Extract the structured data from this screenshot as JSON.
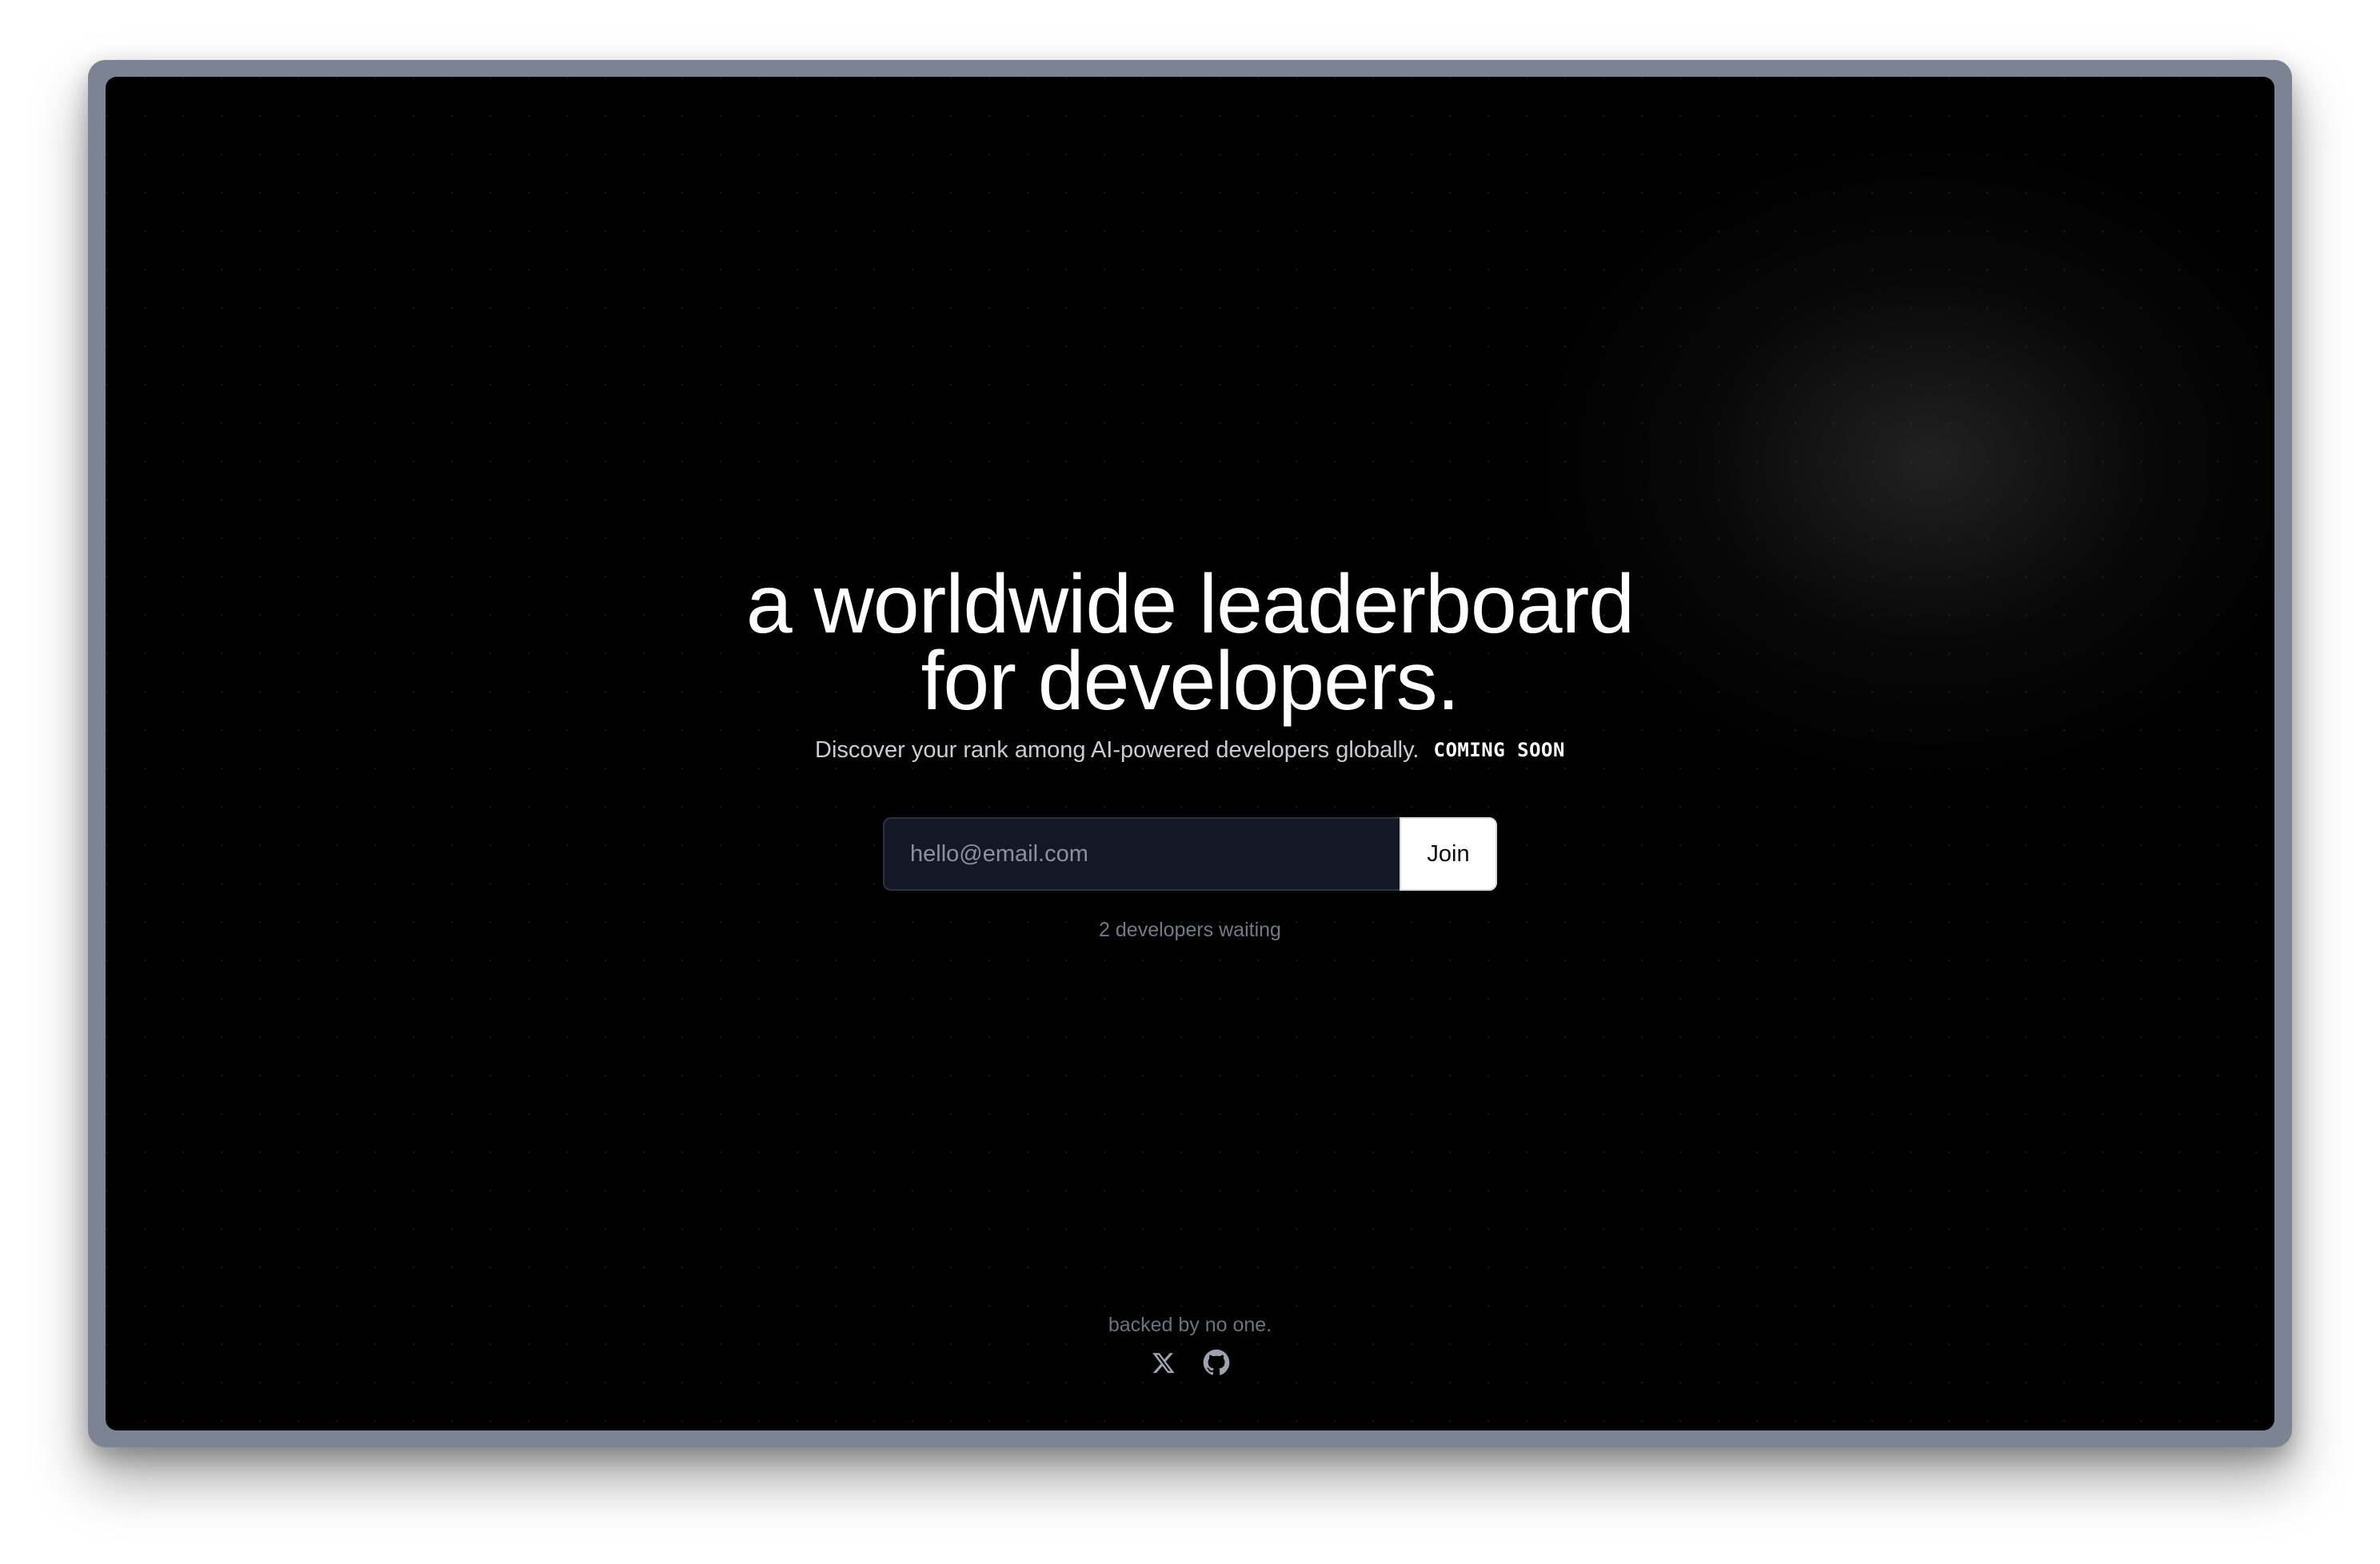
{
  "hero": {
    "title_line1": "a worldwide leaderboard",
    "title_line2": "for developers.",
    "subtitle": "Discover your rank among AI-powered developers globally.",
    "badge": "COMING SOON"
  },
  "signup": {
    "email_placeholder": "hello@email.com",
    "email_value": "",
    "join_label": "Join"
  },
  "waitlist": {
    "count_text": "2 developers waiting"
  },
  "footer": {
    "tagline": "backed by no one.",
    "social_icons": [
      "x-icon",
      "github-icon"
    ]
  },
  "colors": {
    "background": "#000000",
    "frame": "#7c8494",
    "input_background": "#121826",
    "button_background": "#ffffff",
    "muted_text": "#737a86"
  }
}
